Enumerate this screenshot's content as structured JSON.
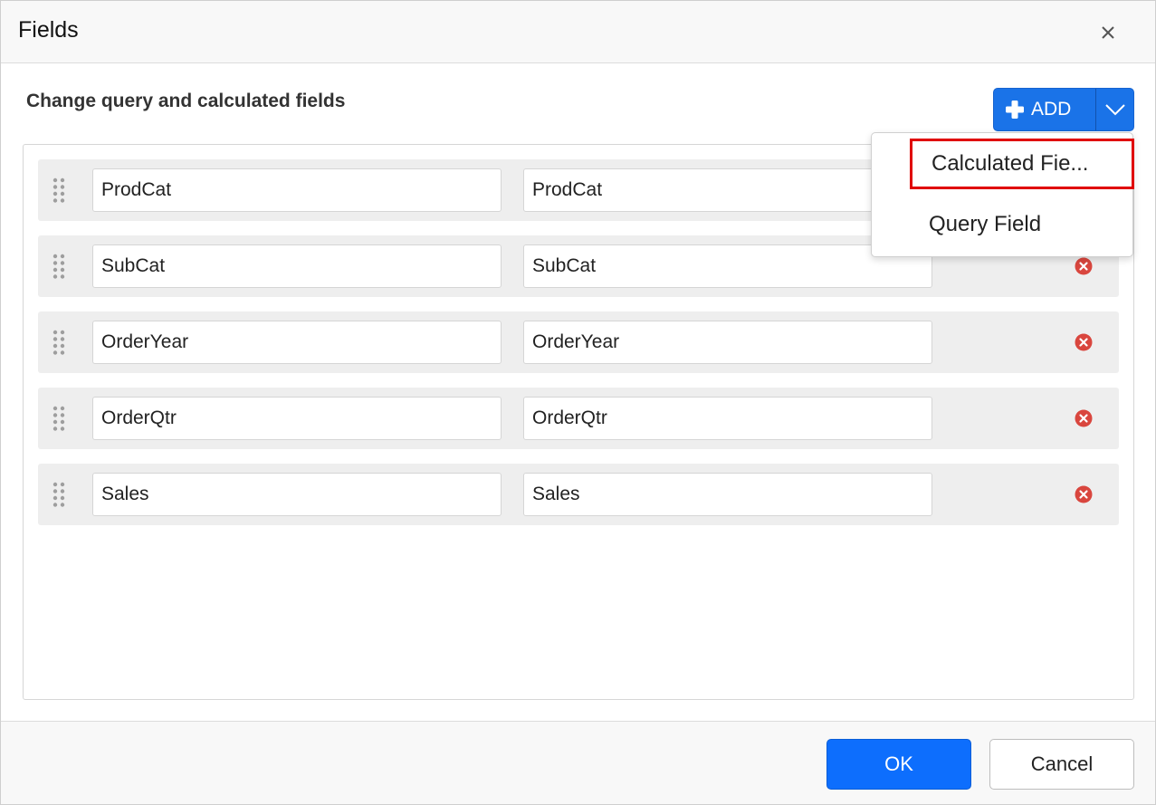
{
  "dialog": {
    "title": "Fields",
    "subtitle": "Change query and calculated fields"
  },
  "icons": {
    "close": "close-icon",
    "plus": "plus-icon",
    "dropdown": "chevron-down-icon",
    "grip": "drag-handle-icon",
    "remove": "remove-circle-icon"
  },
  "colors": {
    "accent": "#1a73e8",
    "primary_button": "#0d6efd",
    "remove": "#d9463e",
    "highlight": "#e00000",
    "row_background": "#eeeeee"
  },
  "add_button": {
    "label": "ADD"
  },
  "add_menu": {
    "items": [
      {
        "label": "Calculated Fie..."
      },
      {
        "label": "Query Field"
      }
    ]
  },
  "fields": [
    {
      "name": "ProdCat",
      "alias": "ProdCat"
    },
    {
      "name": "SubCat",
      "alias": "SubCat"
    },
    {
      "name": "OrderYear",
      "alias": "OrderYear"
    },
    {
      "name": "OrderQtr",
      "alias": "OrderQtr"
    },
    {
      "name": "Sales",
      "alias": "Sales"
    }
  ],
  "footer": {
    "ok_label": "OK",
    "cancel_label": "Cancel"
  }
}
